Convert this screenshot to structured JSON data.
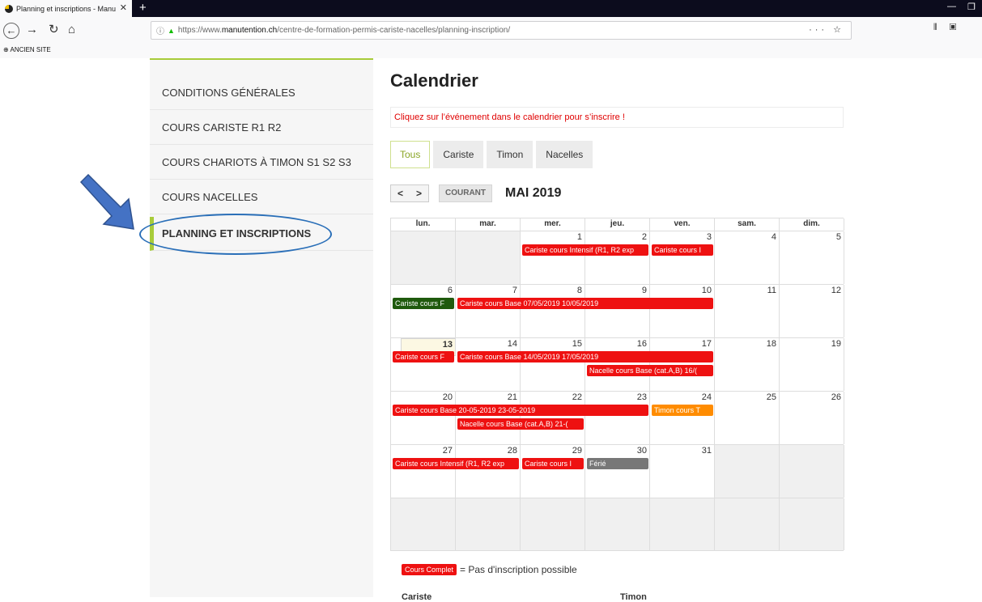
{
  "browser": {
    "tab_title": "Planning et inscriptions - Manu",
    "url_prefix": "https://www.",
    "url_domain": "manutention.ch",
    "url_path": "/centre-de-formation-permis-cariste-nacelles/planning-inscription/",
    "bookmark_label": "ANCIEN SITE"
  },
  "sidebar": {
    "items": [
      {
        "label": "CONDITIONS GÉNÉRALES"
      },
      {
        "label": "COURS CARISTE R1 R2"
      },
      {
        "label": "COURS CHARIOTS À TIMON S1 S2 S3"
      },
      {
        "label": "COURS NACELLES"
      },
      {
        "label": "PLANNING ET INSCRIPTIONS"
      }
    ]
  },
  "main": {
    "title": "Calendrier",
    "notice": "Cliquez sur l’événement dans le calendrier pour s’inscrire !",
    "filters": [
      "Tous",
      "Cariste",
      "Timon",
      "Nacelles"
    ],
    "today_button": "COURANT",
    "month": "MAI 2019"
  },
  "calendar": {
    "days_header": [
      "lun.",
      "mar.",
      "mer.",
      "jeu.",
      "ven.",
      "sam.",
      "dim."
    ],
    "weeks": [
      [
        "",
        "",
        "1",
        "2",
        "3",
        "4",
        "5"
      ],
      [
        "6",
        "7",
        "8",
        "9",
        "10",
        "11",
        "12"
      ],
      [
        "13",
        "14",
        "15",
        "16",
        "17",
        "18",
        "19"
      ],
      [
        "20",
        "21",
        "22",
        "23",
        "24",
        "25",
        "26"
      ],
      [
        "27",
        "28",
        "29",
        "30",
        "31",
        "",
        ""
      ],
      [
        "",
        "",
        "",
        "",
        "",
        "",
        ""
      ]
    ],
    "events": [
      {
        "label": "Cariste cours Intensif (R1, R2 exp",
        "color": "red"
      },
      {
        "label": "Cariste cours I",
        "color": "red"
      },
      {
        "label": "Cariste cours F",
        "color": "green"
      },
      {
        "label": "Cariste cours Base 07/05/2019 10/05/2019",
        "color": "red"
      },
      {
        "label": "Cariste cours F",
        "color": "red"
      },
      {
        "label": "Cariste cours Base 14/05/2019 17/05/2019",
        "color": "red"
      },
      {
        "label": "Nacelle cours Base (cat.A,B) 16/(",
        "color": "red"
      },
      {
        "label": "Cariste cours Base 20-05-2019 23-05-2019",
        "color": "red"
      },
      {
        "label": "Timon cours T",
        "color": "orange"
      },
      {
        "label": "Nacelle cours Base (cat.A,B) 21-(",
        "color": "red"
      },
      {
        "label": "Cariste cours Intensif (R1, R2 exp",
        "color": "red"
      },
      {
        "label": "Cariste cours I",
        "color": "red"
      },
      {
        "label": "Férié",
        "color": "grey"
      }
    ]
  },
  "legend": {
    "badge": "Cours Complet",
    "text": "= Pas d'inscription possible",
    "col1": "Cariste",
    "col2": "Timon"
  }
}
